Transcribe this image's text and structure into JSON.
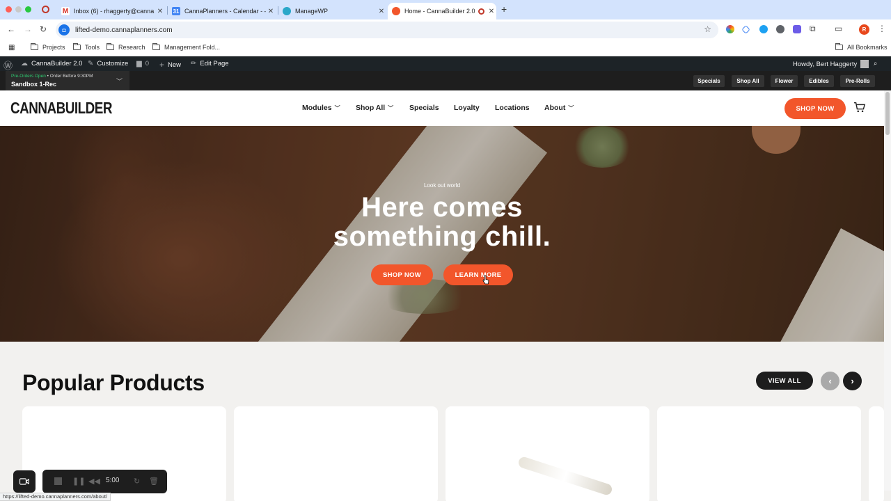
{
  "browser": {
    "tabs": [
      {
        "title": "Inbox (6) - rhaggerty@canna",
        "icon": "gmail-icon"
      },
      {
        "title": "CannaPlanners - Calendar - –",
        "icon": "calendar-icon"
      },
      {
        "title": "ManageWP",
        "icon": "managewp-icon"
      },
      {
        "title": "Home - CannaBuilder 2.0",
        "icon": "cannabuilder-icon"
      }
    ],
    "url": "lifted-demo.cannaplanners.com",
    "bookmarks": [
      "Projects",
      "Tools",
      "Research",
      "Management Fold..."
    ],
    "all_bookmarks": "All Bookmarks",
    "status_url": "https://lifted-demo.cannaplanners.com/about/"
  },
  "wp_admin": {
    "site_name": "CannaBuilder 2.0",
    "customize": "Customize",
    "comments": "0",
    "new": "New",
    "edit_page": "Edit Page",
    "howdy": "Howdy, Bert Haggerty"
  },
  "store": {
    "status_open": "Pre-Orders Open",
    "status_rest": " • Order Before 9:30PM",
    "name": "Sandbox 1-Rec",
    "chips": [
      "Specials",
      "Shop All",
      "Flower",
      "Edibles",
      "Pre-Rolls"
    ]
  },
  "header": {
    "logo": "CANNABUILDER",
    "nav": [
      "Modules",
      "Shop All",
      "Specials",
      "Loyalty",
      "Locations",
      "About"
    ],
    "cta": "SHOP NOW"
  },
  "hero": {
    "eyebrow": "Look out world",
    "headline_1": "Here comes",
    "headline_2": "something chill.",
    "btn_shop": "SHOP NOW",
    "btn_learn": "LEARN MORE"
  },
  "products": {
    "title": "Popular Products",
    "view_all": "VIEW ALL"
  },
  "recorder": {
    "time": "5:00"
  },
  "colors": {
    "accent": "#f2562b",
    "admin_bar": "#1d2327",
    "tab_strip": "#d3e3fd"
  }
}
